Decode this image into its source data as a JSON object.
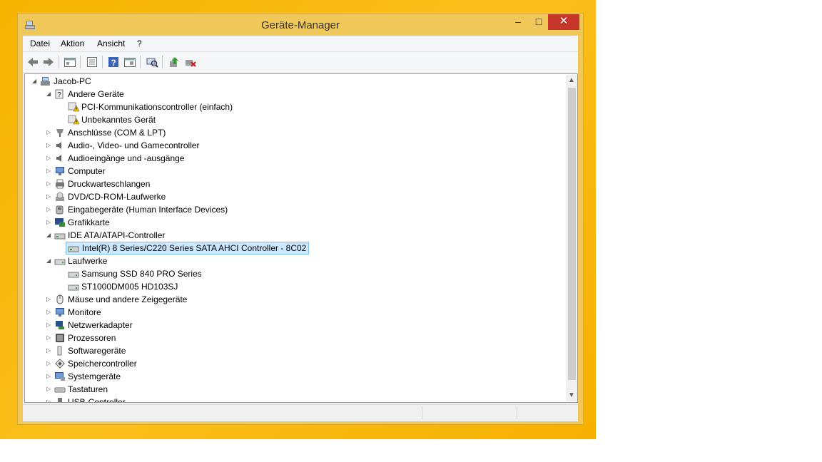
{
  "window": {
    "title": "Geräte-Manager",
    "minimize": "–",
    "maximize": "□",
    "close": "✕"
  },
  "menu": {
    "items": [
      "Datei",
      "Aktion",
      "Ansicht",
      "?"
    ]
  },
  "toolbar": {
    "buttons": [
      "back-icon",
      "forward-icon",
      "properties-window-icon",
      "list-icon",
      "help-icon",
      "details-icon",
      "scan-hardware-icon",
      "update-driver-icon",
      "uninstall-device-icon"
    ]
  },
  "tree": {
    "rows": [
      {
        "label": "Jacob-PC",
        "level": 0,
        "expanded": true,
        "icon": "computer-icon"
      },
      {
        "label": "Andere Geräte",
        "level": 1,
        "expanded": true,
        "icon": "unknown-device-icon"
      },
      {
        "label": "PCI-Kommunikationscontroller (einfach)",
        "level": 2,
        "icon": "warning-device-icon"
      },
      {
        "label": "Unbekanntes Gerät",
        "level": 2,
        "icon": "warning-device-icon"
      },
      {
        "label": "Anschlüsse (COM & LPT)",
        "level": 1,
        "expanded": false,
        "icon": "port-icon"
      },
      {
        "label": "Audio-, Video- und Gamecontroller",
        "level": 1,
        "expanded": false,
        "icon": "speaker-icon"
      },
      {
        "label": "Audioeingänge und -ausgänge",
        "level": 1,
        "expanded": false,
        "icon": "speaker-icon"
      },
      {
        "label": "Computer",
        "level": 1,
        "expanded": false,
        "icon": "monitor-icon"
      },
      {
        "label": "Druckwarteschlangen",
        "level": 1,
        "expanded": false,
        "icon": "printer-icon"
      },
      {
        "label": "DVD/CD-ROM-Laufwerke",
        "level": 1,
        "expanded": false,
        "icon": "dvd-icon"
      },
      {
        "label": "Eingabegeräte (Human Interface Devices)",
        "level": 1,
        "expanded": false,
        "icon": "hid-icon"
      },
      {
        "label": "Grafikkarte",
        "level": 1,
        "expanded": false,
        "icon": "display-adapter-icon"
      },
      {
        "label": "IDE ATA/ATAPI-Controller",
        "level": 1,
        "expanded": true,
        "icon": "controller-icon"
      },
      {
        "label": "Intel(R) 8 Series/C220 Series  SATA AHCI Controller - 8C02",
        "level": 2,
        "icon": "controller-icon",
        "selected": true
      },
      {
        "label": "Laufwerke",
        "level": 1,
        "expanded": true,
        "icon": "drive-icon"
      },
      {
        "label": "Samsung SSD 840 PRO Series",
        "level": 2,
        "icon": "drive-icon"
      },
      {
        "label": "ST1000DM005 HD103SJ",
        "level": 2,
        "icon": "drive-icon"
      },
      {
        "label": "Mäuse und andere Zeigegeräte",
        "level": 1,
        "expanded": false,
        "icon": "mouse-icon"
      },
      {
        "label": "Monitore",
        "level": 1,
        "expanded": false,
        "icon": "monitor-icon"
      },
      {
        "label": "Netzwerkadapter",
        "level": 1,
        "expanded": false,
        "icon": "network-icon"
      },
      {
        "label": "Prozessoren",
        "level": 1,
        "expanded": false,
        "icon": "cpu-icon"
      },
      {
        "label": "Softwaregeräte",
        "level": 1,
        "expanded": false,
        "icon": "software-device-icon"
      },
      {
        "label": "Speichercontroller",
        "level": 1,
        "expanded": false,
        "icon": "storage-controller-icon"
      },
      {
        "label": "Systemgeräte",
        "level": 1,
        "expanded": false,
        "icon": "system-device-icon"
      },
      {
        "label": "Tastaturen",
        "level": 1,
        "expanded": false,
        "icon": "keyboard-icon"
      },
      {
        "label": "USB-Controller",
        "level": 1,
        "expanded": false,
        "icon": "usb-icon"
      }
    ]
  },
  "colors": {
    "desktop": "#f7b400",
    "frame": "#f0c85a",
    "close": "#c7362a",
    "selection": "#cce8ff"
  }
}
